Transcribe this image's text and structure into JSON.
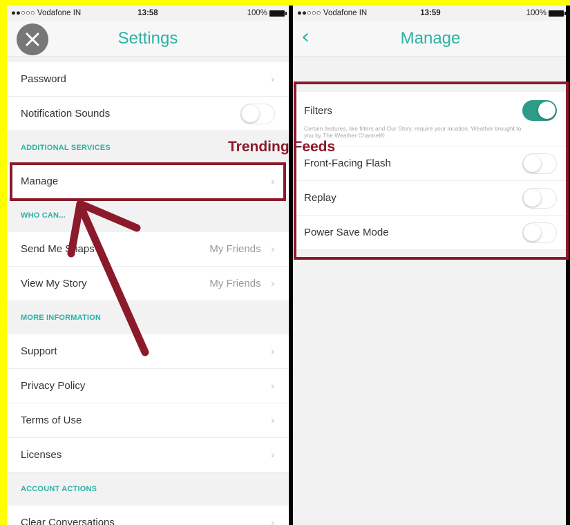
{
  "left": {
    "status": {
      "carrier": "●●○○○ Vodafone IN",
      "time": "13:58",
      "battery": "100%"
    },
    "title": "Settings",
    "rows_top": [
      {
        "label": "Password",
        "type": "link"
      },
      {
        "label": "Notification Sounds",
        "type": "toggle",
        "on": false
      }
    ],
    "section_additional": "ADDITIONAL SERVICES",
    "manage_label": "Manage",
    "section_who": "WHO CAN...",
    "rows_who": [
      {
        "label": "Send Me Snaps",
        "value": "My Friends"
      },
      {
        "label": "View My Story",
        "value": "My Friends"
      }
    ],
    "section_more": "MORE INFORMATION",
    "rows_more": [
      {
        "label": "Support"
      },
      {
        "label": "Privacy Policy"
      },
      {
        "label": "Terms of Use"
      },
      {
        "label": "Licenses"
      }
    ],
    "section_account": "ACCOUNT ACTIONS",
    "rows_account": [
      {
        "label": "Clear Conversations"
      }
    ]
  },
  "right": {
    "status": {
      "carrier": "●●○○○ Vodafone IN",
      "time": "13:59",
      "battery": "100%"
    },
    "title": "Manage",
    "filters": {
      "label": "Filters",
      "on": true,
      "description": "Certain features, like filters and Our Story, require your location. Weather brought to you by The Weather Channel®."
    },
    "rows": [
      {
        "label": "Front-Facing Flash",
        "on": false
      },
      {
        "label": "Replay",
        "on": false
      },
      {
        "label": "Power Save Mode",
        "on": false
      }
    ]
  },
  "annotation": {
    "text": "Trending Feeds"
  },
  "colors": {
    "accent": "#2cb1a4",
    "annotation": "#8b1a2b",
    "background_border": "#ffff00"
  },
  "icons": {
    "close": "close-icon",
    "back": "chevron-left-icon",
    "row": "chevron-right-icon"
  }
}
